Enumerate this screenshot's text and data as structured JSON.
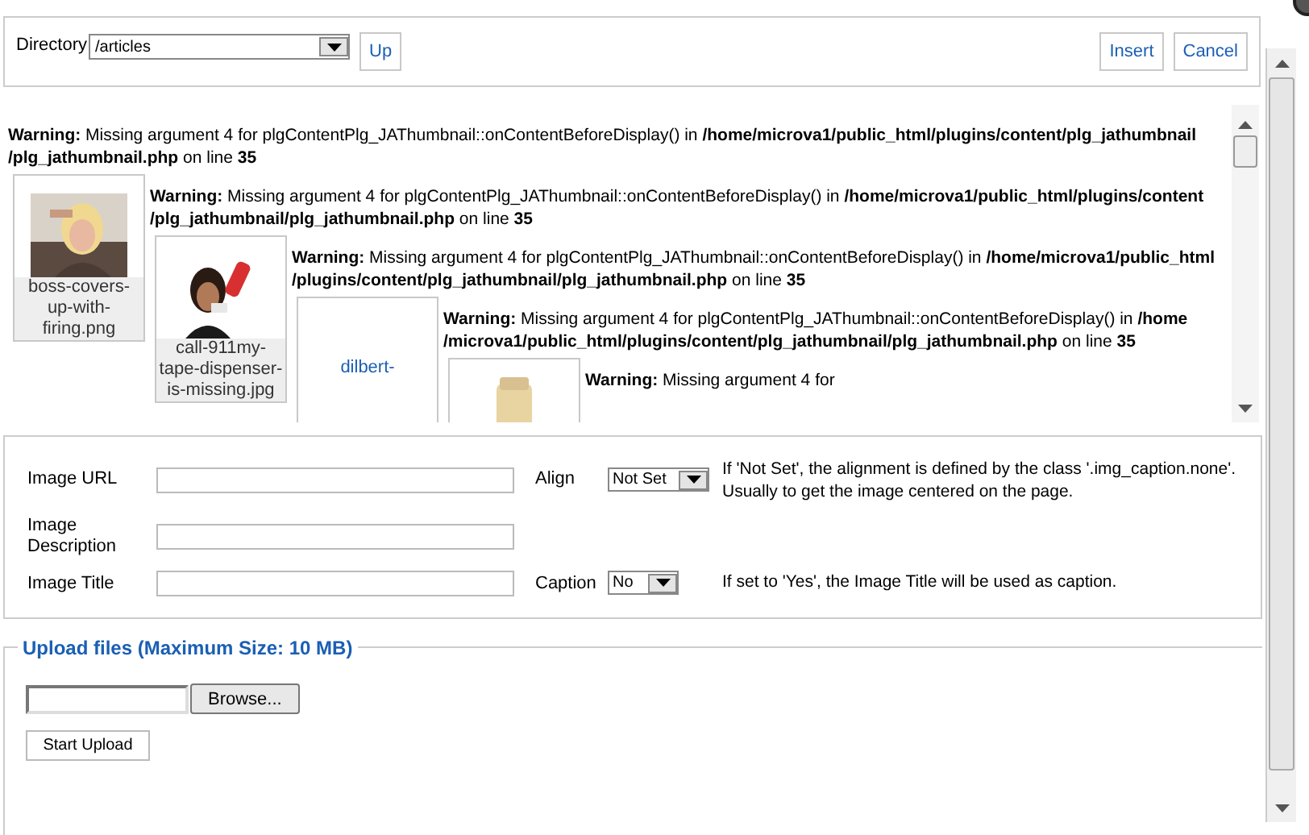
{
  "toolbar": {
    "directory_label": "Directory",
    "directory_value": "/articles",
    "up_button": "Up",
    "insert_button": "Insert",
    "cancel_button": "Cancel"
  },
  "entries": [
    {
      "warning": "**Warning:** Missing argument 4 for plgContentPlg_JAThumbnail::onContentBeforeDisplay() in **/home/microva1/public_html/plugins/content/plg_jathumbnail/plg_jathumbnail.php** on line **35**",
      "thumbnail": {
        "kind": "picture",
        "caption": "boss-covers-up-with-firing.png"
      }
    },
    {
      "warning": "**Warning:** Missing argument 4 for plgContentPlg_JAThumbnail::onContentBeforeDisplay() in **/home/microva1/public_html/plugins/content/plg_jathumbnail/plg_jathumbnail.php** on line **35**",
      "thumbnail": {
        "kind": "picture",
        "caption": "call-911my-tape-dispenser-is-missing.jpg"
      }
    },
    {
      "warning": "**Warning:** Missing argument 4 for plgContentPlg_JAThumbnail::onContentBeforeDisplay() in **/home/microva1/public_html/plugins/content/plg_jathumbnail/plg_jathumbnail.php** on line **35**",
      "thumbnail": {
        "kind": "broken",
        "alt": "dilbert-"
      }
    },
    {
      "warning": "**Warning:** Missing argument 4 for plgContentPlg_JAThumbnail::onContentBeforeDisplay() in **/home/microva1/public_html/plugins/content/plg_jathumbnail/plg_jathumbnail.php** on line **35**"
    },
    {
      "warning": "**Warning:** Missing argument 4 for"
    }
  ],
  "form": {
    "image_url_label": "Image URL",
    "image_description_label": "Image Description",
    "image_title_label": "Image Title",
    "align_label": "Align",
    "align_value": "Not Set",
    "align_hint": "If 'Not Set', the alignment is defined by the class '.img_caption.none'. Usually to get the image centered on the page.",
    "caption_label": "Caption",
    "caption_value": "No",
    "caption_hint": "If set to 'Yes', the Image Title will be used as caption."
  },
  "upload": {
    "legend": "Upload files (Maximum Size: 10 MB)",
    "browse_button": "Browse...",
    "start_button": "Start Upload"
  }
}
